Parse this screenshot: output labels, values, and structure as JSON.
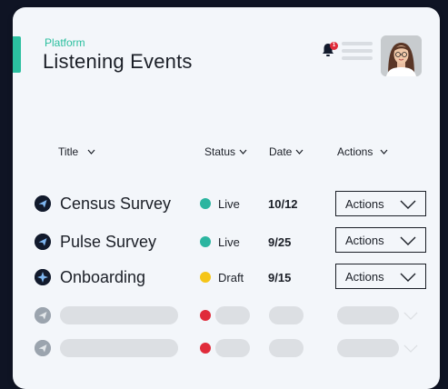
{
  "header": {
    "section_label": "Platform",
    "title": "Listening Events",
    "notification_count": "1"
  },
  "table": {
    "columns": [
      "Title",
      "Status",
      "Date",
      "Actions"
    ],
    "rows": [
      {
        "title": "Census Survey",
        "status": "Live",
        "status_color": "#2bb5a0",
        "date": "10/12",
        "action_label": "Actions",
        "icon": "paper-plane-icon"
      },
      {
        "title": "Pulse Survey",
        "status": "Live",
        "status_color": "#2bb5a0",
        "date": "9/25",
        "action_label": "Actions",
        "icon": "paper-plane-icon"
      },
      {
        "title": "Onboarding",
        "status": "Draft",
        "status_color": "#f5c518",
        "date": "9/15",
        "action_label": "Actions",
        "icon": "sparkle-icon"
      }
    ],
    "placeholder_rows": 2,
    "placeholder_status_color": "#e02b3a"
  },
  "colors": {
    "accent": "#2bbf9f",
    "background": "#f3f6fa"
  }
}
